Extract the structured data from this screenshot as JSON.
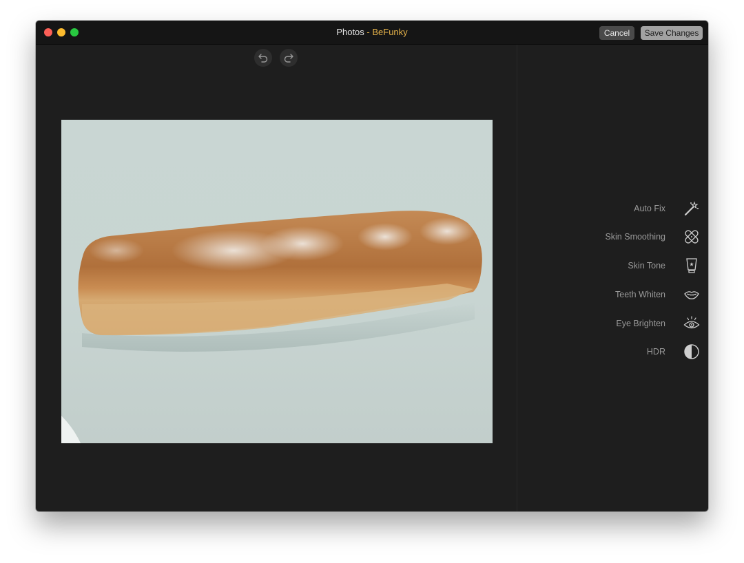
{
  "window": {
    "title_part1": "Photos",
    "title_sep": " - ",
    "title_part2": "BeFunky"
  },
  "toolbar": {
    "cancel_label": "Cancel",
    "save_label": "Save Changes"
  },
  "history": {
    "undo_icon": "undo-icon",
    "redo_icon": "redo-icon"
  },
  "tools": [
    {
      "label": "Auto Fix",
      "icon": "magic-wand-icon"
    },
    {
      "label": "Skin Smoothing",
      "icon": "bandage-icon"
    },
    {
      "label": "Skin Tone",
      "icon": "cream-bottle-icon"
    },
    {
      "label": "Teeth Whiten",
      "icon": "lips-icon"
    },
    {
      "label": "Eye Brighten",
      "icon": "eye-icon"
    },
    {
      "label": "HDR",
      "icon": "hdr-icon"
    }
  ],
  "colors": {
    "window_bg": "#1e1e1e",
    "titlebar_bg": "#151515",
    "accent": "#e6b34a",
    "tool_text": "#9a9a9a"
  }
}
